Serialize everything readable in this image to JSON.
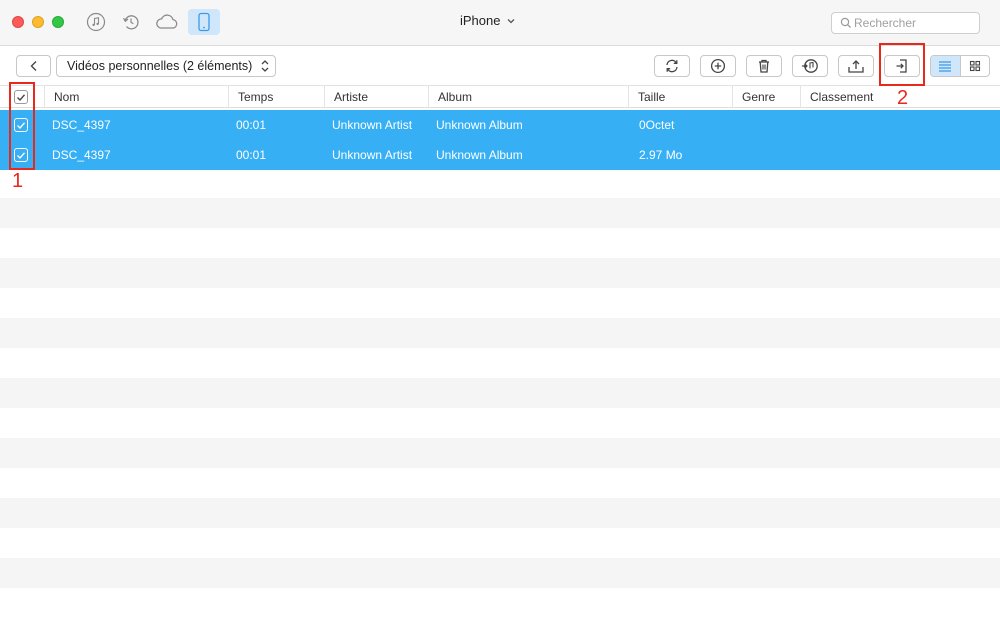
{
  "window": {
    "title": "iPhone"
  },
  "top_icons": [
    "music-icon",
    "restore-icon",
    "cloud-icon",
    "phone-icon"
  ],
  "search": {
    "placeholder": "Rechercher"
  },
  "toolbar": {
    "category_label": "Vidéos personnelles (2 éléments)",
    "actions": [
      "refresh-icon",
      "add-icon",
      "trash-icon",
      "to-itunes-icon",
      "to-device-icon",
      "to-computer-icon"
    ],
    "view_modes": [
      "list-view-icon",
      "grid-view-icon"
    ],
    "active_view": "list"
  },
  "table": {
    "columns": [
      "Nom",
      "Temps",
      "Artiste",
      "Album",
      "Taille",
      "Genre",
      "Classement"
    ],
    "rows": [
      {
        "name": "DSC_4397",
        "time": "00:01",
        "artist": "Unknown Artist",
        "album": "Unknown Album",
        "size": "0Octet",
        "genre": "",
        "rating": "",
        "checked": true,
        "selected": true
      },
      {
        "name": "DSC_4397",
        "time": "00:01",
        "artist": "Unknown Artist",
        "album": "Unknown Album",
        "size": "2.97 Mo",
        "genre": "",
        "rating": "",
        "checked": true,
        "selected": true
      }
    ],
    "select_all_checked": true
  },
  "annotations": [
    {
      "label": "1"
    },
    {
      "label": "2"
    }
  ],
  "colors": {
    "selection": "#36aff5",
    "annotation": "#e8281c",
    "active_tab": "#cfe6fb"
  }
}
